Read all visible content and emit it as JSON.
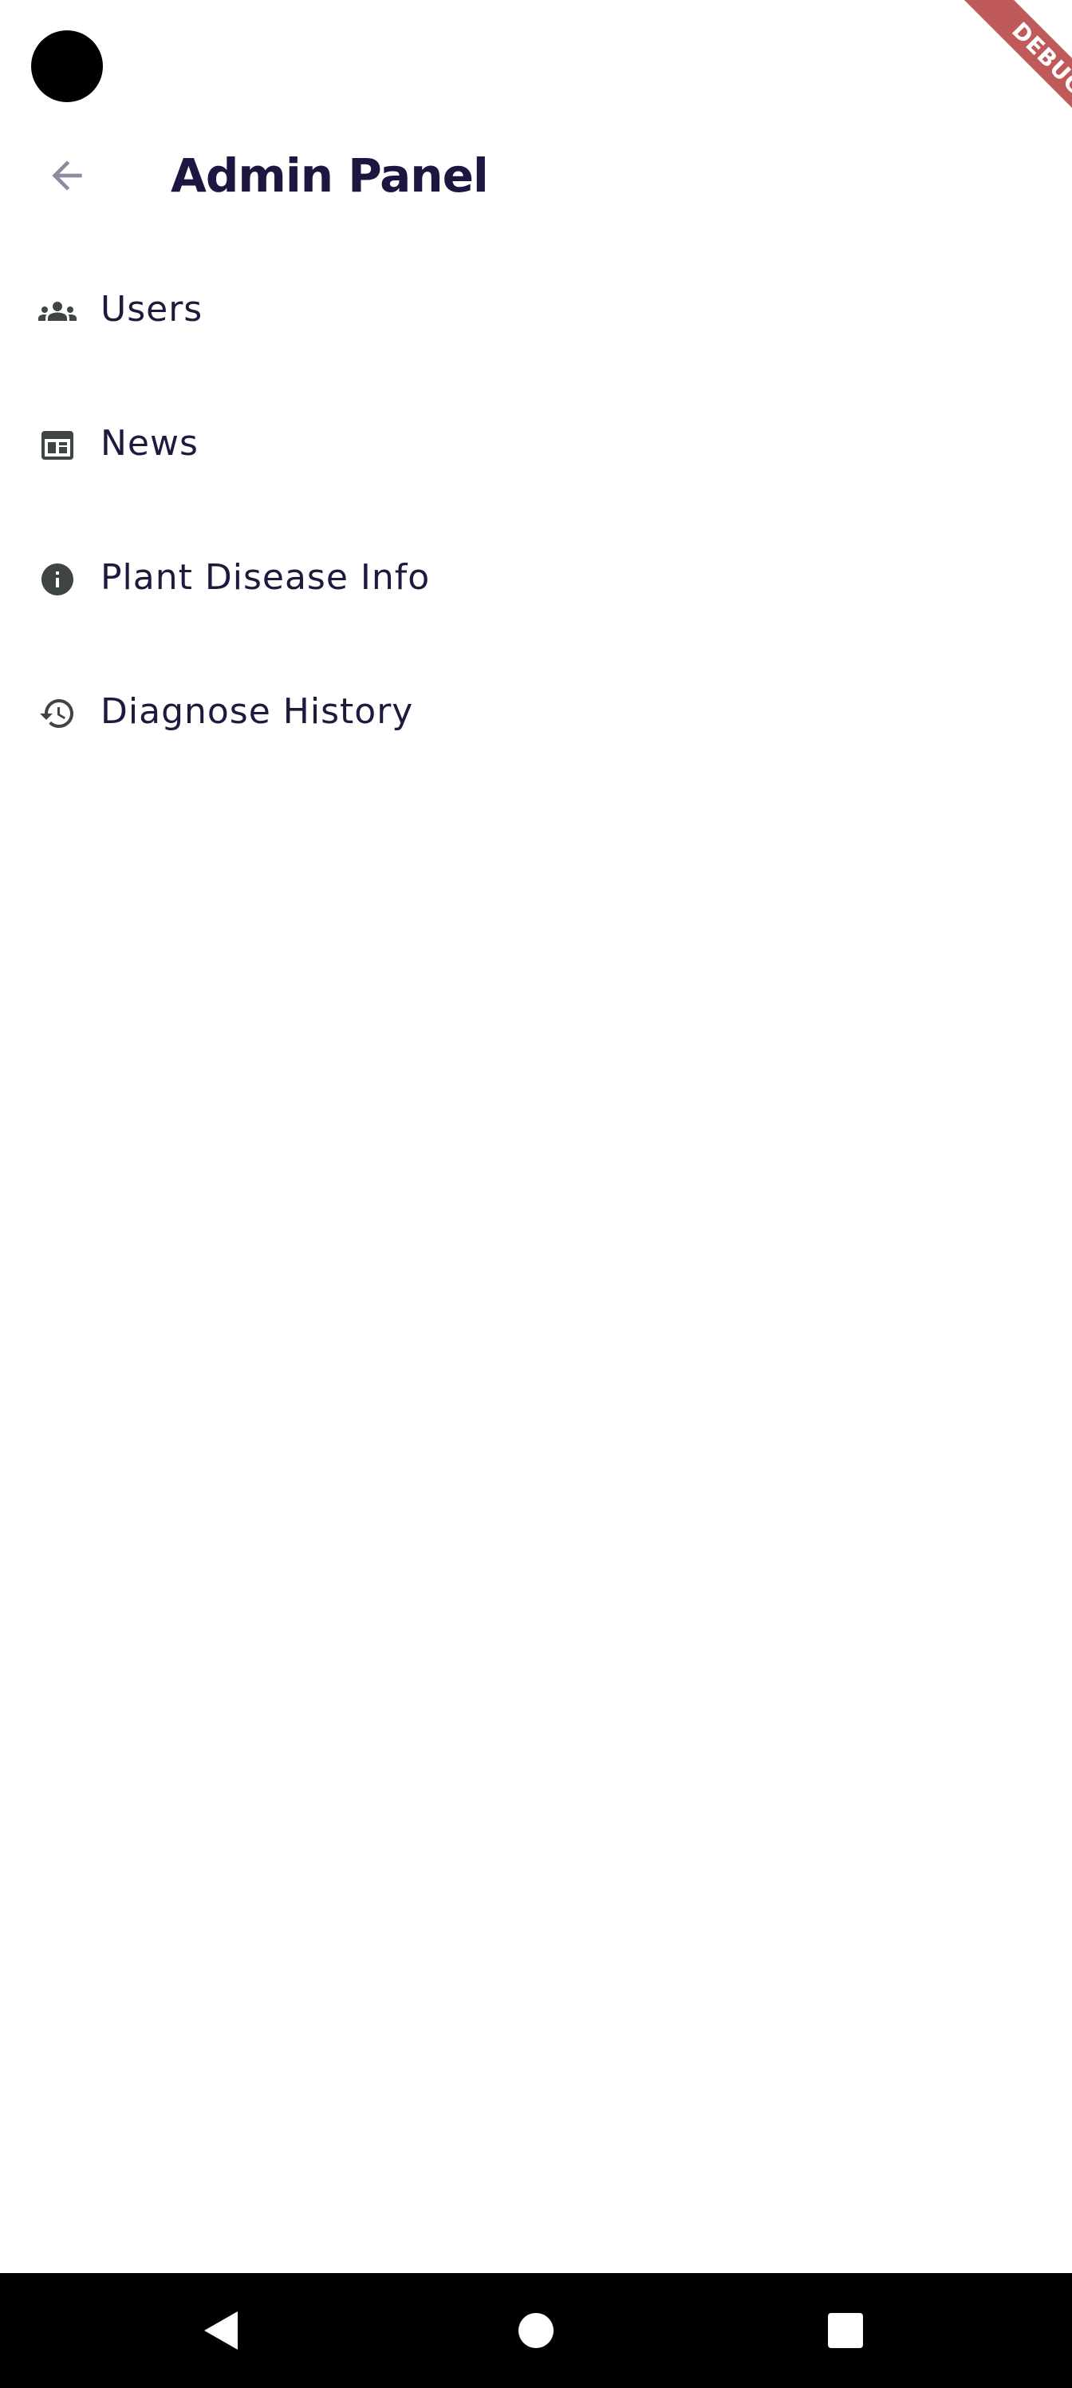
{
  "app_bar": {
    "title": "Admin Panel",
    "back_icon": "arrow-back-icon"
  },
  "debug_banner": {
    "label": "DEBUG"
  },
  "menu": {
    "items": [
      {
        "label": "Users",
        "icon": "people-icon"
      },
      {
        "label": "News",
        "icon": "newspaper-icon"
      },
      {
        "label": "Plant Disease Info",
        "icon": "info-icon"
      },
      {
        "label": "Diagnose History",
        "icon": "history-icon"
      }
    ]
  },
  "nav_bar": {
    "buttons": [
      "back-triangle-icon",
      "home-circle-icon",
      "recents-square-icon"
    ]
  },
  "colors": {
    "title": "#1c1640",
    "label": "#1c1a3d",
    "icon": "#3f4540",
    "back_arrow": "#8f8aa0",
    "debug_ribbon": "#b03030",
    "nav_background": "#000000"
  }
}
